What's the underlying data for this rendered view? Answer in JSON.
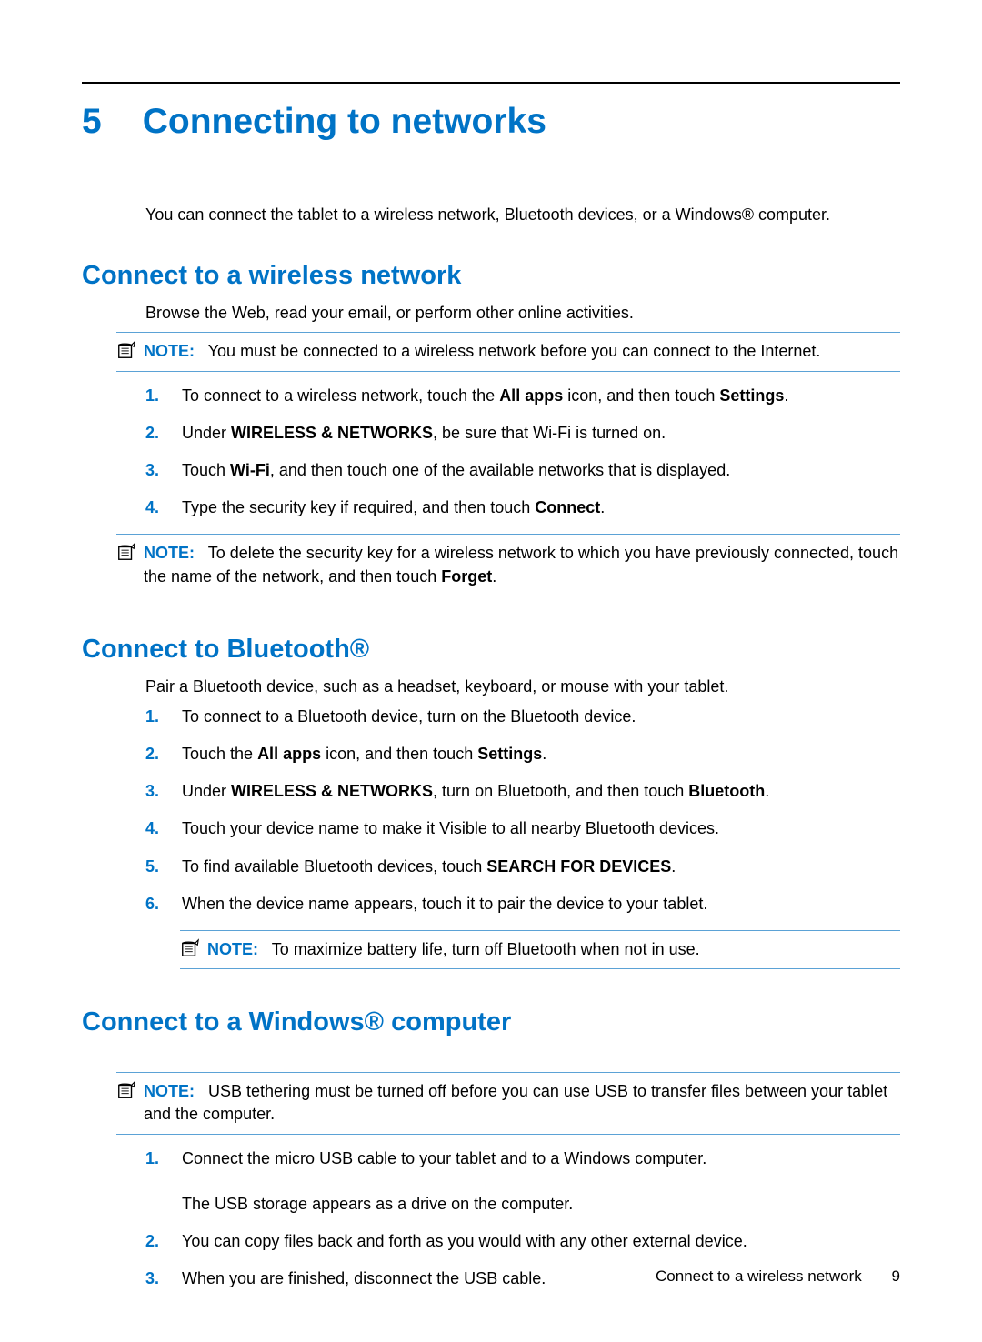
{
  "chapter": {
    "number": "5",
    "title": "Connecting to networks"
  },
  "intro": "You can connect the tablet to a wireless network, Bluetooth devices, or a Windows® computer.",
  "sections": {
    "wifi": {
      "title": "Connect to a wireless network",
      "intro": "Browse the Web, read your email, or perform other online activities.",
      "note1_label": "NOTE:",
      "note1_text": "You must be connected to a wireless network before you can connect to the Internet.",
      "steps": [
        "To connect to a wireless network, touch the <b>All apps</b> icon, and then touch <b>Settings</b>.",
        "Under <b>WIRELESS & NETWORKS</b>, be sure that Wi-Fi is turned on.",
        "Touch <b>Wi-Fi</b>, and then touch one of the available networks that is displayed.",
        "Type the security key if required, and then touch <b>Connect</b>."
      ],
      "note2_label": "NOTE:",
      "note2_text": "To delete the security key for a wireless network to which you have previously connected, touch the name of the network, and then touch <b>Forget</b>."
    },
    "bt": {
      "title": "Connect to Bluetooth®",
      "intro": "Pair a Bluetooth device, such as a headset, keyboard, or mouse with your tablet.",
      "steps": [
        "To connect to a Bluetooth device, turn on the Bluetooth device.",
        "Touch the <b>All apps</b> icon, and then touch <b>Settings</b>.",
        "Under <b>WIRELESS & NETWORKS</b>, turn on Bluetooth, and then touch <b>Bluetooth</b>.",
        "Touch your device name to make it Visible to all nearby Bluetooth devices.",
        "To find available Bluetooth devices, touch <b>SEARCH FOR DEVICES</b>.",
        "When the device name appears, touch it to pair the device to your tablet."
      ],
      "note_label": "NOTE:",
      "note_text": "To maximize battery life, turn off Bluetooth when not in use."
    },
    "win": {
      "title": "Connect to a Windows® computer",
      "note_label": "NOTE:",
      "note_text": "USB tethering must be turned off before you can use USB to transfer files between your tablet and the computer.",
      "steps": [
        "Connect the micro USB cable to your tablet and to a Windows computer.<br><br>The USB storage appears as a drive on the computer.",
        "You can copy files back and forth as you would with any other external device.",
        "When you are finished, disconnect the USB cable."
      ]
    }
  },
  "footer": {
    "text": "Connect to a wireless network",
    "page": "9"
  }
}
